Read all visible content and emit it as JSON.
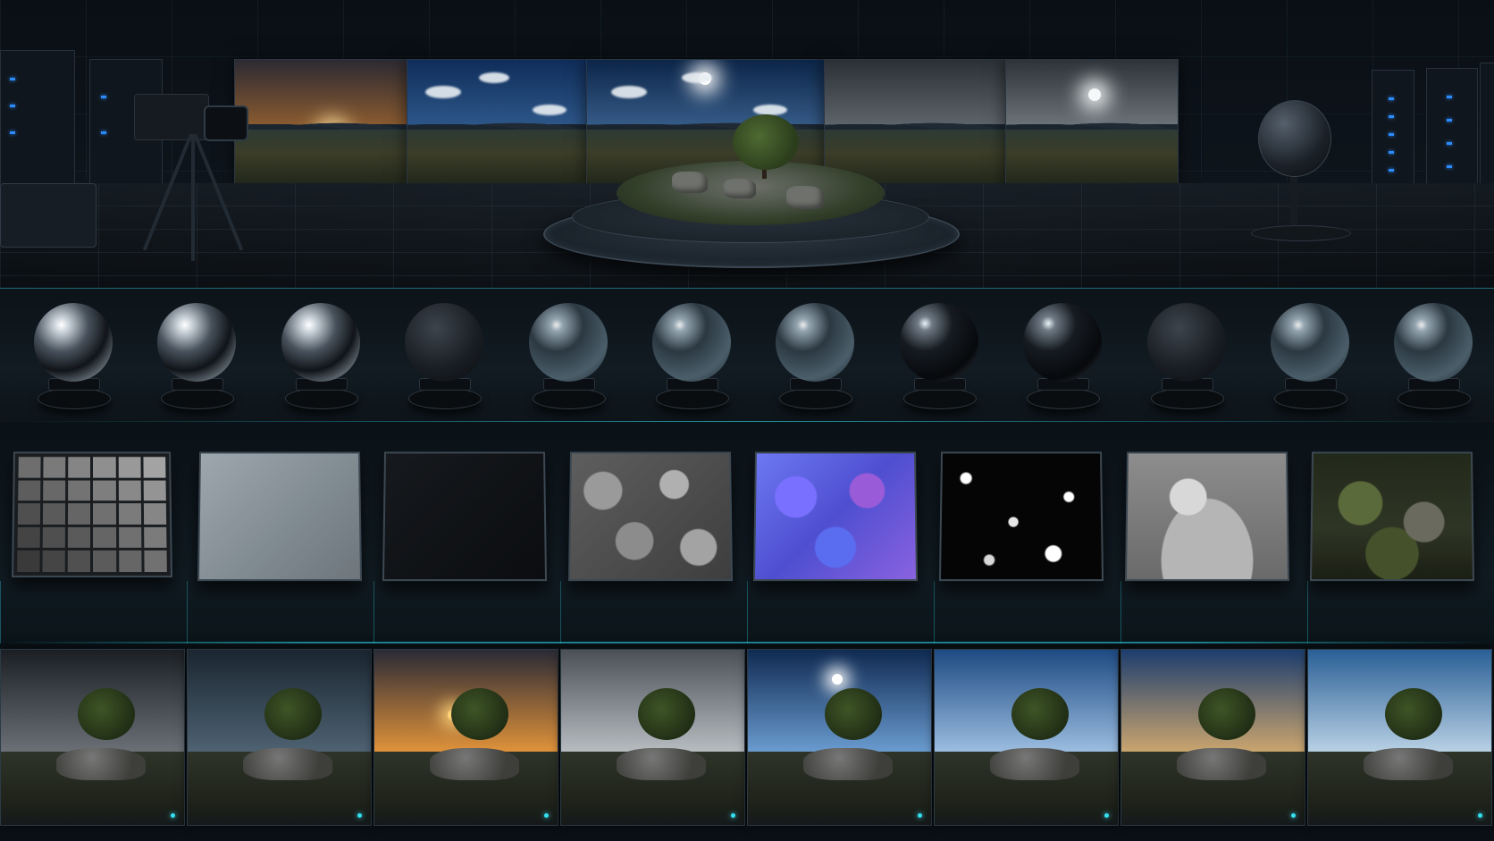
{
  "scene": "hdri-lighting-studio",
  "accent_color": "#2ad4e6",
  "stage": {
    "hdri_panels": [
      {
        "name": "sunset",
        "sky_top": "#2c2a33",
        "sky_bottom": "#e58a2c",
        "sun_color": "#ffe2a0"
      },
      {
        "name": "blue-sky-clouds",
        "sky_top": "#0f2d5a",
        "sky_bottom": "#4a7fb6",
        "sun_color": ""
      },
      {
        "name": "clear-sky-sun",
        "sky_top": "#0c2548",
        "sky_bottom": "#5d8fc4",
        "sun_color": "#ffffff"
      },
      {
        "name": "overcast",
        "sky_top": "#2a3036",
        "sky_bottom": "#8e969c",
        "sun_color": ""
      },
      {
        "name": "overcast-sun",
        "sky_top": "#2d3338",
        "sky_bottom": "#a8b0b6",
        "sun_color": "#f5f7f8"
      }
    ],
    "equipment": [
      "cinema-camera",
      "tripod",
      "equipment-case",
      "server-racks",
      "spherical-360-camera",
      "turntable"
    ]
  },
  "material_probes": [
    {
      "material": "chrome"
    },
    {
      "material": "chrome"
    },
    {
      "material": "chrome"
    },
    {
      "material": "matte"
    },
    {
      "material": "glass"
    },
    {
      "material": "glass"
    },
    {
      "material": "glass"
    },
    {
      "material": "glossy"
    },
    {
      "material": "glossy"
    },
    {
      "material": "matte"
    },
    {
      "material": "glass"
    },
    {
      "material": "glass"
    }
  ],
  "texture_maps": [
    {
      "kind": "color-checker"
    },
    {
      "kind": "gray-card"
    },
    {
      "kind": "black-card"
    },
    {
      "kind": "height-map"
    },
    {
      "kind": "normal-map"
    },
    {
      "kind": "specular-map"
    },
    {
      "kind": "ao-map"
    },
    {
      "kind": "albedo-map"
    }
  ],
  "checker_swatches": [
    "#6e6e6e",
    "#7a7a7a",
    "#858585",
    "#8f8f8f",
    "#999999",
    "#a3a3a3",
    "#5d5d5d",
    "#686868",
    "#737373",
    "#7e7e7e",
    "#898989",
    "#949494",
    "#4f4f4f",
    "#5a5a5a",
    "#656565",
    "#707070",
    "#7b7b7b",
    "#868686",
    "#444444",
    "#4f4f4f",
    "#5a5a5a",
    "#656565",
    "#707070",
    "#7b7b7b",
    "#3a3a3a",
    "#454545",
    "#505050",
    "#5b5b5b",
    "#666666",
    "#717171"
  ],
  "render_previews": [
    {
      "lighting": "stormy",
      "sky_top": "#1b1f24",
      "sky_bottom": "#6a7076",
      "sun": ""
    },
    {
      "lighting": "dusk-overcast",
      "sky_top": "#1a2630",
      "sky_bottom": "#4e6272",
      "sun": ""
    },
    {
      "lighting": "sunset",
      "sky_top": "#2a2a36",
      "sky_bottom": "#e0923a",
      "sun": "#ffd27a"
    },
    {
      "lighting": "overcast",
      "sky_top": "#4a5056",
      "sky_bottom": "#b6bcc0",
      "sun": ""
    },
    {
      "lighting": "clear-sky-sun",
      "sky_top": "#0f2a52",
      "sky_bottom": "#6a9bcf",
      "sun": "#ffffff"
    },
    {
      "lighting": "blue-sky-clouds",
      "sky_top": "#1d4a82",
      "sky_bottom": "#9bbde0",
      "sun": ""
    },
    {
      "lighting": "golden-clouds",
      "sky_top": "#1c3d6e",
      "sky_bottom": "#caa56e",
      "sun": ""
    },
    {
      "lighting": "day-clouds",
      "sky_top": "#2a5f96",
      "sky_bottom": "#b8d0e4",
      "sun": ""
    }
  ]
}
